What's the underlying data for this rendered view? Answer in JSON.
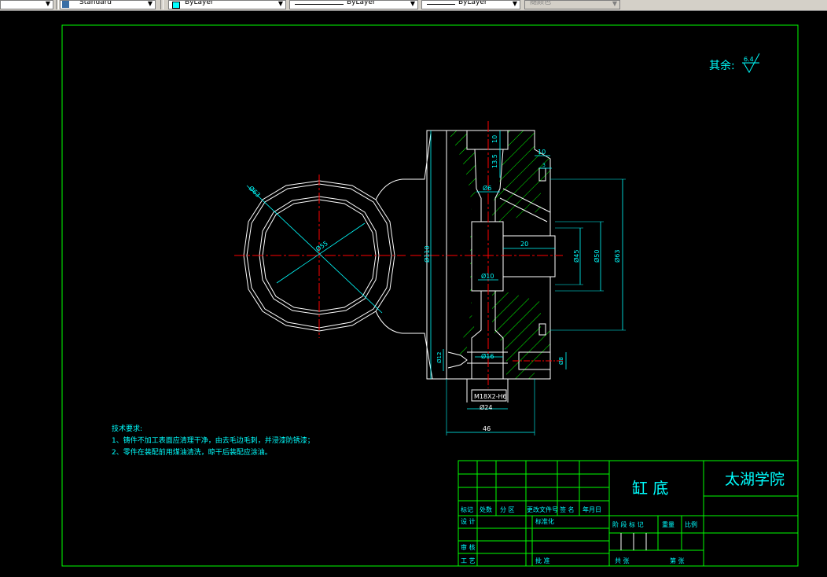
{
  "toolbar": {
    "left_dropdown_arrow": "▼",
    "text_style": "Standard",
    "layer_color": "ByLayer",
    "linetype": "ByLayer",
    "lineweight": "ByLayer",
    "plot_style": "随颜色"
  },
  "colors": {
    "background": "#000000",
    "frame": "#00ff00",
    "outline": "#ffffff",
    "centerline": "#ff0000",
    "dimension": "#00ffff",
    "hatch": "#00ff00",
    "text_cyan": "#00ffff"
  },
  "drawing": {
    "roughness_label": "其余:",
    "roughness_value": "6.4",
    "dimensions": {
      "d63_circle": "Ø63",
      "d55_circle": "Ø55",
      "h110": "Ø110",
      "top10": "10",
      "top13_5": "13.5",
      "side10": "10",
      "side3": "3",
      "d6": "Ø6",
      "len20": "20",
      "d45": "Ø45",
      "d50": "Ø50",
      "d63_right": "Ø63",
      "d10": "Ø10",
      "d16": "Ø16",
      "d12": "Ø12",
      "d8": "Ø8",
      "thread": "M18X2-H6",
      "d24": "Ø24",
      "w46": "46"
    },
    "tech_req": {
      "title": "技术要求:",
      "line1": "1、铸件不加工表面应清理干净，由去毛边毛刺，并浸漆防锈漆；",
      "line2": "2、零件在装配前用煤油清洗，晾干后装配应涂油。"
    }
  },
  "title_block": {
    "part_name": "缸 底",
    "school": "太湖学院",
    "row_labels": [
      "标记",
      "处数",
      "分 区",
      "更改文件号",
      "签 名",
      "年月日"
    ],
    "designer": "设 计",
    "standardize": "标准化",
    "stage_mark": "阶 段 标 记",
    "weight": "重量",
    "scale": "比例",
    "review": "审 核",
    "process": "工 艺",
    "approve": "批 准",
    "sheet_total": "共 张",
    "sheet_num": "第 张"
  }
}
